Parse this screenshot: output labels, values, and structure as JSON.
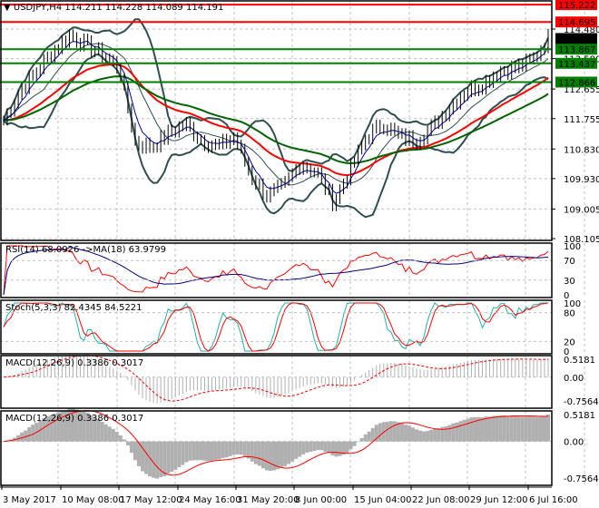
{
  "header": {
    "symbol": "USDJPY,H4",
    "ohlc": "114.211 114.228 114.089 114.191"
  },
  "chart_data": [
    {
      "type": "line",
      "title": "USDJPY,H4",
      "ylim": [
        108.105,
        115.222
      ],
      "y_ticks": [
        "114.480",
        "113.580",
        "112.655",
        "111.755",
        "110.830",
        "109.930",
        "109.005",
        "108.105"
      ],
      "x_ticks": [
        "3 May 2017",
        "10 May 08:00",
        "17 May 12:00",
        "24 May 16:00",
        "31 May 20:00",
        "8 Jun 00:00",
        "15 Jun 04:00",
        "22 Jun 08:00",
        "29 Jun 12:00",
        "6 Jul 16:00"
      ],
      "close_approx": [
        111.7,
        112.6,
        113.2,
        113.8,
        114.3,
        114.0,
        113.7,
        113.3,
        111.0,
        110.9,
        111.3,
        111.6,
        111.1,
        110.9,
        111.2,
        110.0,
        109.4,
        109.7,
        110.4,
        110.1,
        109.2,
        110.2,
        111.2,
        111.6,
        111.2,
        111.1,
        111.5,
        112.1,
        112.6,
        112.8,
        113.2,
        113.3,
        113.5,
        114.2
      ],
      "levels": [
        {
          "label": "115.222",
          "color": "#ff0000"
        },
        {
          "label": "114.695",
          "color": "#ff0000"
        },
        {
          "label": "114.191",
          "color": "#000000"
        },
        {
          "label": "113.867",
          "color": "#008000"
        },
        {
          "label": "113.437",
          "color": "#008000"
        },
        {
          "label": "112.866",
          "color": "#008000"
        }
      ],
      "grid": true
    },
    {
      "type": "line",
      "title": "RSI(14) 68.0926  ->MA(18) 63.9799",
      "ylim": [
        0,
        100
      ],
      "y_ticks": [
        "100",
        "70",
        "30",
        "0"
      ],
      "colors": [
        "#ff0000",
        "#000080"
      ]
    },
    {
      "type": "line",
      "title": "Stoch(5,3,3) 82.4345 84.5221",
      "ylim": [
        0,
        100
      ],
      "y_ticks": [
        "100",
        "80",
        "20",
        "0"
      ],
      "colors": [
        "#20b2aa",
        "#ff0000"
      ]
    },
    {
      "type": "bar",
      "title": "MACD(12,26,9) 0.3386 0.3017",
      "ylim": [
        -0.7564,
        0.5181
      ],
      "y_ticks": [
        "0.5181",
        "0.00",
        "-0.7564"
      ]
    },
    {
      "type": "area",
      "title": "MACD(12,26,9) 0.3386 0.3017",
      "ylim": [
        -0.7564,
        0.5181
      ],
      "y_ticks": [
        "0.5181",
        "0.00",
        "-0.7564"
      ]
    }
  ]
}
